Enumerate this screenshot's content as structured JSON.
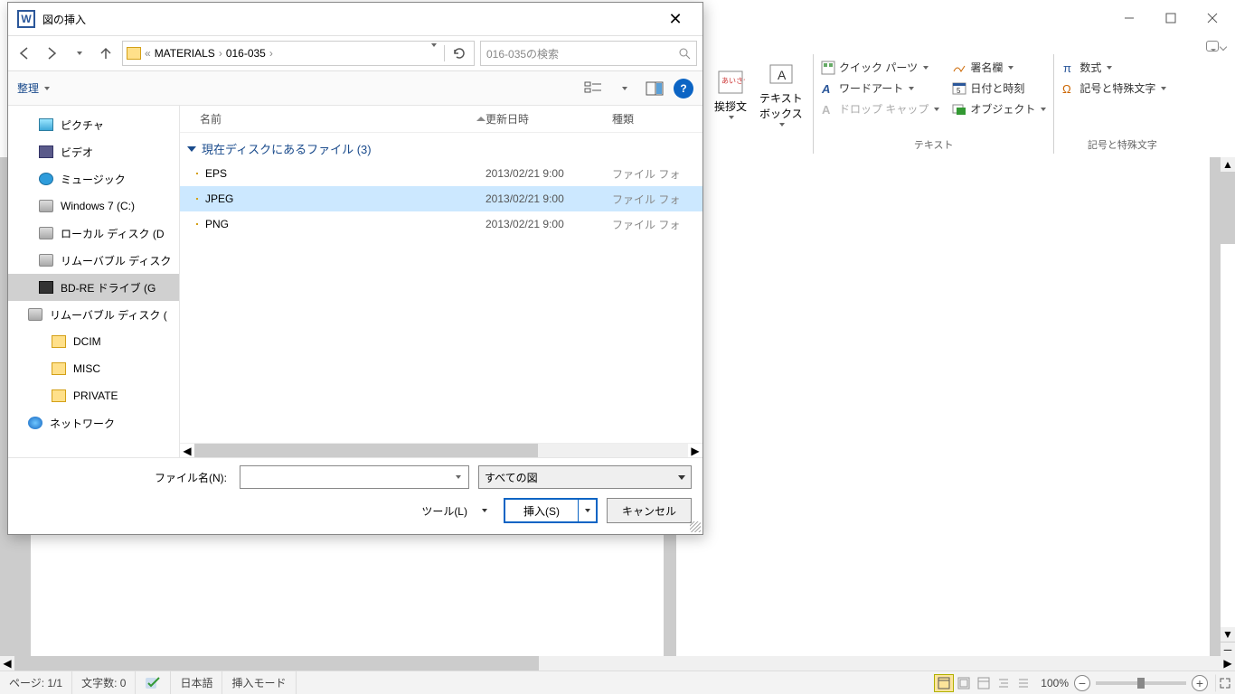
{
  "word": {
    "ribbon": {
      "group1": {
        "aisatsu": "挨拶文",
        "textbox": "テキスト\nボックス"
      },
      "group2": {
        "quickparts": "クイック パーツ",
        "wordart": "ワードアート",
        "dropcap": "ドロップ キャップ",
        "signature": "署名欄",
        "datetime": "日付と時刻",
        "object": "オブジェクト",
        "label": "テキスト"
      },
      "group3": {
        "equation": "数式",
        "symbol": "記号と特殊文字",
        "label": "記号と特殊文字"
      }
    },
    "status": {
      "page": "ページ: 1/1",
      "words": "文字数: 0",
      "lang": "日本語",
      "mode": "挿入モード",
      "zoom": "100%"
    }
  },
  "dialog": {
    "title": "図の挿入",
    "breadcrumbs": {
      "prefix": "«",
      "p1": "MATERIALS",
      "p2": "016-035"
    },
    "search_placeholder": "016-035の検索",
    "organize": "整理",
    "nav": [
      {
        "label": "ピクチャ",
        "cls": "picicon"
      },
      {
        "label": "ビデオ",
        "cls": "vidicon"
      },
      {
        "label": "ミュージック",
        "cls": "musicon"
      },
      {
        "label": "Windows 7 (C:)",
        "cls": "driveicon"
      },
      {
        "label": "ローカル ディスク (D",
        "cls": "driveicon"
      },
      {
        "label": "リムーバブル ディスク",
        "cls": "driveicon"
      },
      {
        "label": "BD-RE ドライブ (G",
        "cls": "bdicon",
        "sel": true
      },
      {
        "label": "リムーバブル ディスク (",
        "cls": "driveicon",
        "lv": 1
      },
      {
        "label": "DCIM",
        "cls": "foldericon",
        "lv": 2
      },
      {
        "label": "MISC",
        "cls": "foldericon",
        "lv": 2
      },
      {
        "label": "PRIVATE",
        "cls": "foldericon",
        "lv": 2
      },
      {
        "label": "ネットワーク",
        "cls": "neticon",
        "lv": 1
      }
    ],
    "columns": {
      "name": "名前",
      "date": "更新日時",
      "type": "種類"
    },
    "group_header": "現在ディスクにあるファイル (3)",
    "rows": [
      {
        "name": "EPS",
        "date": "2013/02/21 9:00",
        "type": "ファイル フォ",
        "sel": false
      },
      {
        "name": "JPEG",
        "date": "2013/02/21 9:00",
        "type": "ファイル フォ",
        "sel": true
      },
      {
        "name": "PNG",
        "date": "2013/02/21 9:00",
        "type": "ファイル フォ",
        "sel": false
      }
    ],
    "footer": {
      "filename_label": "ファイル名(N):",
      "filter": "すべての図",
      "tools": "ツール(L)",
      "insert": "挿入(S)",
      "cancel": "キャンセル"
    }
  }
}
